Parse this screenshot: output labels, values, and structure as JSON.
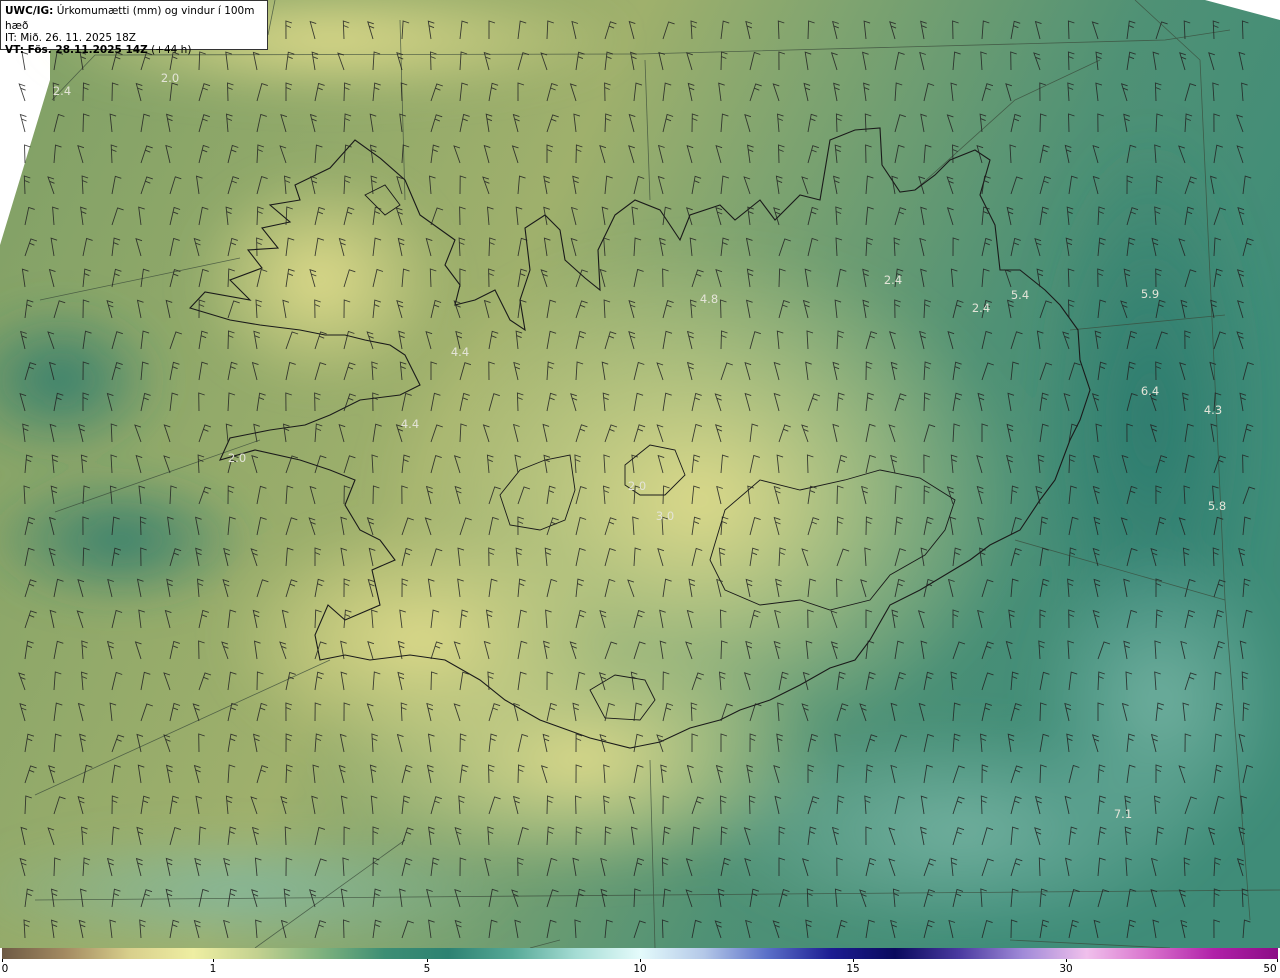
{
  "header": {
    "model": "UWC/IG:",
    "title": "Úrkomumætti (mm) og vindur í 100m hæð",
    "init_time": "IT: Mið. 26. 11. 2025 18Z",
    "valid_label": "VT: Fös. 28.11.2025 14Z",
    "lead": "(+44 h)"
  },
  "values": [
    {
      "id": "v1",
      "text": "2.4"
    },
    {
      "id": "v2",
      "text": "2.0"
    },
    {
      "id": "v3",
      "text": "4.8"
    },
    {
      "id": "v4",
      "text": "2.4"
    },
    {
      "id": "v5",
      "text": "5.4"
    },
    {
      "id": "v6",
      "text": "2.4"
    },
    {
      "id": "v7",
      "text": "5.9"
    },
    {
      "id": "v8",
      "text": "4.4"
    },
    {
      "id": "v9",
      "text": "4.4"
    },
    {
      "id": "v10",
      "text": "2.0"
    },
    {
      "id": "v11",
      "text": "6.4"
    },
    {
      "id": "v12",
      "text": "4.3"
    },
    {
      "id": "v13",
      "text": "2.0"
    },
    {
      "id": "v14",
      "text": "3.0"
    },
    {
      "id": "v15",
      "text": "5.8"
    },
    {
      "id": "v16",
      "text": "7.1"
    }
  ],
  "colorbar": {
    "ticks": [
      "0",
      "1",
      "5",
      "10",
      "15",
      "30",
      "50"
    ],
    "colors": [
      "#6e5a44",
      "#a48b62",
      "#d8cf8c",
      "#eeeea2",
      "#c3d190",
      "#7fb27e",
      "#3d8e74",
      "#2d8272",
      "#57a997",
      "#a5dcd4",
      "#e4fbfb",
      "#b4c8e8",
      "#5a6fc8",
      "#1c1c92",
      "#0a0a5e",
      "#4a3aa0",
      "#a08ad8",
      "#f0c0ec",
      "#d870cc",
      "#b020a8",
      "#8c0c86"
    ]
  }
}
